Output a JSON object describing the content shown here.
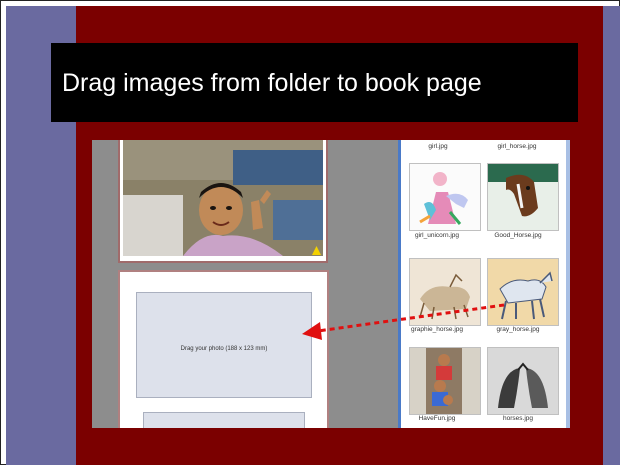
{
  "slide": {
    "title": "Drag images from folder to book page",
    "colors": {
      "background": "#7b0000",
      "side_panels": "#6a6aa0",
      "title_box": "#000000",
      "arrow": "#e01010"
    }
  },
  "book_page": {
    "drop_zone_text": "Drag your photo (188 x 123 mm)"
  },
  "folder": {
    "items": [
      {
        "label": "girl.jpg"
      },
      {
        "label": "girl_horse.jpg"
      },
      {
        "label": "girl_unicorn.jpg"
      },
      {
        "label": "Good_Horse.jpg"
      },
      {
        "label": "graphie_horse.jpg"
      },
      {
        "label": "gray_horse.jpg"
      },
      {
        "label": "HaveFun.jpg"
      },
      {
        "label": "horses.jpg"
      }
    ]
  }
}
